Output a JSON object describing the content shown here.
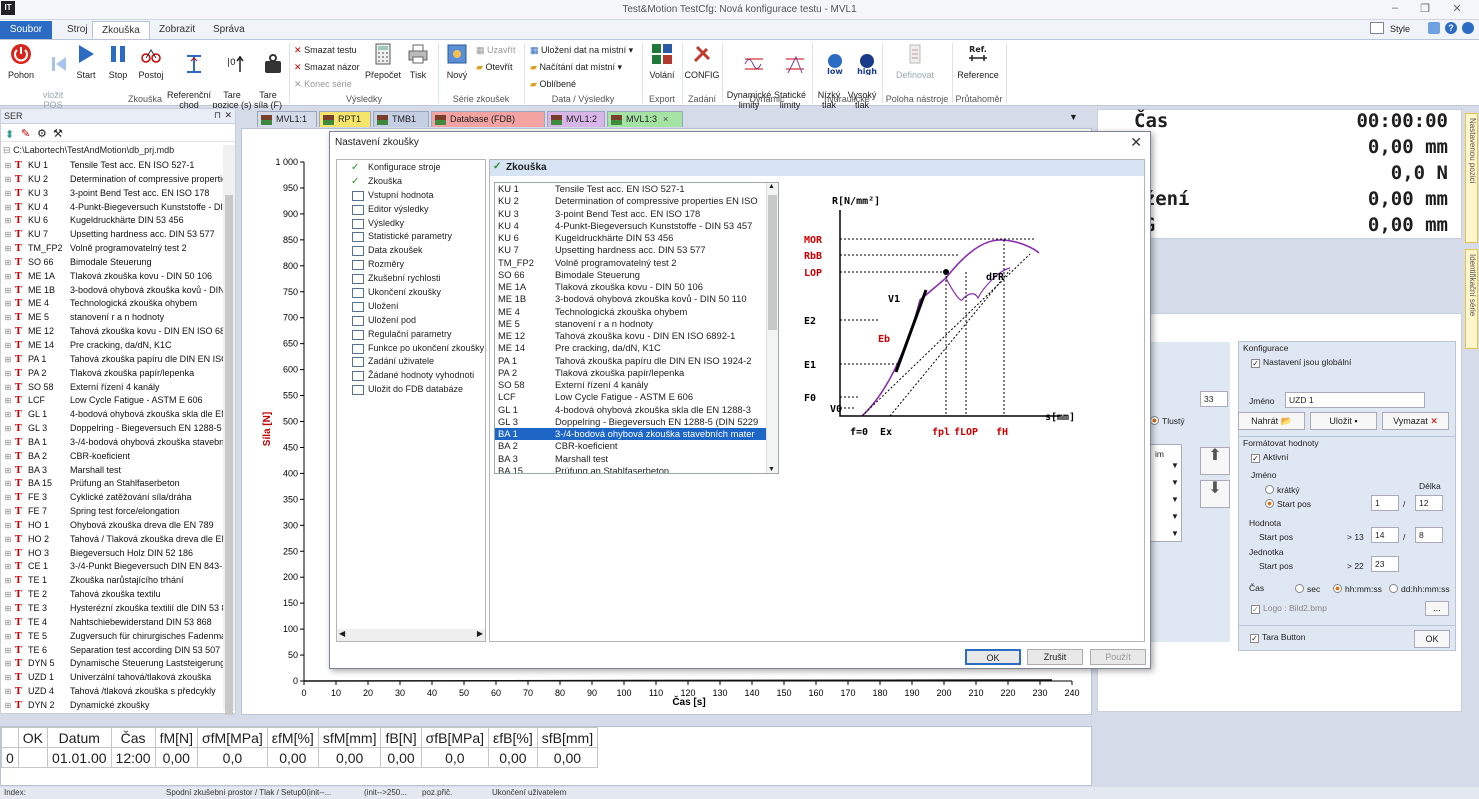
{
  "app": {
    "logo": "IT",
    "title": "Test&Motion  TestCfg: Nová konfigurace testu -  MVL1",
    "style_label": "Style"
  },
  "ribbon_tabs": [
    "Soubor",
    "Stroj",
    "Zkouška",
    "Zobrazit",
    "Správa"
  ],
  "ribbon": {
    "zkouska": {
      "buttons": [
        "Pohon",
        "vložit\nPOS",
        "Start",
        "Stop",
        "Postoj",
        "Referenční\nchod",
        "Tare\npozice (s)",
        "Tare\nsíla (F)"
      ],
      "group": "Zkouška"
    },
    "vysledky": {
      "smazat_testu": "Smazat testu",
      "smazat_nazor": "Smazat názor",
      "konec_serie": "Konec série",
      "prepocet": "Přepočet",
      "tisk": "Tisk",
      "group": "Výsledky"
    },
    "serie": {
      "novy": "Nový",
      "uzavrit": "Uzavřít",
      "otevrit": "Otevřít",
      "group": "Série zkoušek"
    },
    "data": {
      "ulozeni": "Uložení dat na místní",
      "nacitani": "Načítání dat místní",
      "oblibene": "Oblíbené",
      "group": "Data / Výsledky"
    },
    "export": {
      "volani": "Volání",
      "group": "Export"
    },
    "zadani": {
      "config": "CONFIG",
      "group": "Zadání"
    },
    "dynamic": {
      "dyn": "Dynamické\nlimity",
      "stat": "Statické\nlimity",
      "group": "Dynamic"
    },
    "hydraulic": {
      "low": "Nízký\ntlak",
      "high": "Vysoký\ntlak",
      "low_badge": "low",
      "high_badge": "high",
      "group": "hydraulické"
    },
    "poloha": {
      "definovat": "Definovat",
      "group": "Poloha nástroje"
    },
    "prutahomer": {
      "reference": "Reference",
      "ref_badge": "Ref.",
      "group": "Průtahoměr"
    }
  },
  "left_panel": {
    "title": "SER",
    "path": "C:\\Labortech\\TestAndMotion\\db_prj.mdb",
    "items": [
      {
        "code": "KU 1",
        "name": "Tensile Test acc. EN ISO 527-1"
      },
      {
        "code": "KU 2",
        "name": "Determination of compressive properties"
      },
      {
        "code": "KU 3",
        "name": "3-point Bend Test acc. EN ISO 178"
      },
      {
        "code": "KU 4",
        "name": "4-Punkt-Biegeversuch Kunststoffe - DIN"
      },
      {
        "code": "KU 6",
        "name": "Kugeldruckhärte DIN 53 456"
      },
      {
        "code": "KU 7",
        "name": "Upsetting hardness acc. DIN 53 577"
      },
      {
        "code": "TM_FP2",
        "name": "Volně programovatelný test 2"
      },
      {
        "code": "SO 66",
        "name": "Bimodale Steuerung"
      },
      {
        "code": "ME 1A",
        "name": "Tlaková zkouška kovu - DIN 50 106"
      },
      {
        "code": "ME 1B",
        "name": "3-bodová ohybová zkouška kovů - DIN"
      },
      {
        "code": "ME 4",
        "name": "Technologická zkouška ohybem"
      },
      {
        "code": "ME 5",
        "name": "stanovení r a n hodnoty"
      },
      {
        "code": "ME 12",
        "name": "Tahová zkouška kovu - DIN EN ISO 6892"
      },
      {
        "code": "ME 14",
        "name": "Pre cracking, da/dN, K1C"
      },
      {
        "code": "PA 1",
        "name": "Tahová zkouška papíru dle DIN EN ISO 1"
      },
      {
        "code": "PA 2",
        "name": "Tlaková zkouška papír/lepenka"
      },
      {
        "code": "SO 58",
        "name": "Externí řízení 4 kanály"
      },
      {
        "code": "LCF",
        "name": "Low Cycle Fatigue - ASTM E 606"
      },
      {
        "code": "GL 1",
        "name": "4-bodová ohybová zkouška skla dle  EN"
      },
      {
        "code": "GL 3",
        "name": "Doppelring - Biegeversuch EN 1288-5 (D"
      },
      {
        "code": "BA 1",
        "name": "3-/4-bodová ohybová zkouška stavební"
      },
      {
        "code": "BA 2",
        "name": "CBR-koeficient"
      },
      {
        "code": "BA 3",
        "name": "Marshall test"
      },
      {
        "code": "BA 15",
        "name": "Prüfung an Stahlfaserbeton"
      },
      {
        "code": "FE 3",
        "name": "Cyklické zatěžování síla/dráha"
      },
      {
        "code": "FE 7",
        "name": "Spring test force/elongation"
      },
      {
        "code": "HO 1",
        "name": "Ohybová zkouška dreva dle EN 789"
      },
      {
        "code": "HO 2",
        "name": "Tahová / Tlaková zkouška dreva dle EN"
      },
      {
        "code": "HO 3",
        "name": "Biegeversuch Holz  DIN 52 186"
      },
      {
        "code": "CE 1",
        "name": "3-/4-Punkt Biegeversuch DIN EN 843-1,"
      },
      {
        "code": "TE 1",
        "name": "Zkouška narůstajícího trhání"
      },
      {
        "code": "TE 2",
        "name": "Tahová zkouška textilu"
      },
      {
        "code": "TE 3",
        "name": "Hysterézní zkouška textilií dle DIN 53 835"
      },
      {
        "code": "TE 4",
        "name": "Nahtschiebewiderstand DIN 53 868"
      },
      {
        "code": "TE 5",
        "name": "Zugversuch für chirurgisches Fadenmate"
      },
      {
        "code": "TE 6",
        "name": "Separation test according DIN 53 507"
      },
      {
        "code": "DYN 5",
        "name": "Dynamische Steuerung Laststeigerung"
      },
      {
        "code": "UZD 1",
        "name": "Univerzální tahová/tlaková zkouška"
      },
      {
        "code": "UZD 4",
        "name": "Tahová /tlaková zkouška s předcykly"
      },
      {
        "code": "DYN 2",
        "name": "Dynamické zkoušky"
      }
    ]
  },
  "doc_tabs": [
    {
      "label": "MVL1:1",
      "color": "#d6dbe9"
    },
    {
      "label": "RPT1",
      "color": "#f7e46a"
    },
    {
      "label": "TMB1",
      "color": "#c5cfe4"
    },
    {
      "label": "Database (FDB)",
      "color": "#f4a3a3"
    },
    {
      "label": "MVL1:2",
      "color": "#d8b6e8"
    },
    {
      "label": "MVL1:3",
      "color": "#a5e3a5"
    }
  ],
  "chart": {
    "ylabel": "Síla [N]",
    "xlabel": "Čas [s]"
  },
  "chart_data": {
    "type": "line",
    "ylabel": "Síla [N]",
    "xlabel": "Čas [s]",
    "xlim": [
      0,
      240
    ],
    "ylim": [
      0,
      1000
    ],
    "x_ticks": [
      0,
      10,
      20,
      30,
      40,
      50,
      60,
      70,
      80,
      90,
      100,
      110,
      120,
      130,
      140,
      150,
      160,
      170,
      180,
      190,
      200,
      210,
      220,
      230,
      240
    ],
    "y_ticks": [
      0,
      50,
      100,
      150,
      200,
      250,
      300,
      350,
      400,
      450,
      500,
      550,
      600,
      650,
      700,
      750,
      800,
      850,
      900,
      950,
      1000
    ],
    "y_tick_labels": [
      "0",
      "50",
      "100",
      "150",
      "200",
      "250",
      "300",
      "350",
      "400",
      "450",
      "500",
      "550",
      "600",
      "650",
      "700",
      "750",
      "800",
      "850",
      "900",
      "950",
      "1 000"
    ],
    "series": []
  },
  "dialog": {
    "title": "Nastavení zkoušky",
    "close": "✕",
    "header": "Zkouška",
    "nav": [
      {
        "label": "Konfigurace stroje",
        "icon": "check"
      },
      {
        "label": "Zkouška",
        "icon": "check"
      },
      {
        "label": "Vstupní hodnota",
        "icon": "form"
      },
      {
        "label": "Editor výsledky",
        "icon": "form"
      },
      {
        "label": "Výsledky",
        "icon": "form"
      },
      {
        "label": "Statistické parametry",
        "icon": "form"
      },
      {
        "label": "Data zkoušek",
        "icon": "form"
      },
      {
        "label": "Rozměry",
        "icon": "form"
      },
      {
        "label": "Zkušební rychlosti",
        "icon": "form"
      },
      {
        "label": "Ukončení zkoušky",
        "icon": "form"
      },
      {
        "label": "Uložení",
        "icon": "form"
      },
      {
        "label": "Uložení pod",
        "icon": "form"
      },
      {
        "label": "Regulační parametry",
        "icon": "form"
      },
      {
        "label": "Funkce po ukončení zkoušky",
        "icon": "form"
      },
      {
        "label": "Zadání uživatele",
        "icon": "form"
      },
      {
        "label": "Žádané hodnoty vyhodnoti",
        "icon": "form"
      },
      {
        "label": "Uložit do FDB databáze",
        "icon": "form"
      }
    ],
    "tests": [
      {
        "code": "KU 1",
        "name": "Tensile Test acc. EN ISO 527-1"
      },
      {
        "code": "KU 2",
        "name": "Determination of compressive properties EN ISO"
      },
      {
        "code": "KU 3",
        "name": "3-point Bend Test acc. EN ISO 178"
      },
      {
        "code": "KU 4",
        "name": "4-Punkt-Biegeversuch Kunststoffe - DIN 53 457"
      },
      {
        "code": "KU 6",
        "name": "Kugeldruckhärte DIN 53 456"
      },
      {
        "code": "KU 7",
        "name": "Upsetting hardness acc. DIN 53 577"
      },
      {
        "code": "TM_FP2",
        "name": "Volně programovatelný test 2"
      },
      {
        "code": "SO 66",
        "name": "Bimodale Steuerung"
      },
      {
        "code": "ME 1A",
        "name": "Tlaková zkouška kovu - DIN 50 106"
      },
      {
        "code": "ME 1B",
        "name": "3-bodová ohybová zkouška kovů - DIN 50 110"
      },
      {
        "code": "ME 4",
        "name": "Technologická zkouška ohybem"
      },
      {
        "code": "ME 5",
        "name": "stanovení r a n hodnoty"
      },
      {
        "code": "ME 12",
        "name": "Tahová zkouška kovu - DIN EN ISO 6892-1"
      },
      {
        "code": "ME 14",
        "name": "Pre cracking, da/dN, K1C"
      },
      {
        "code": "PA 1",
        "name": "Tahová zkouška papíru dle DIN EN ISO 1924-2"
      },
      {
        "code": "PA 2",
        "name": "Tlaková zkouška papír/lepenka"
      },
      {
        "code": "SO 58",
        "name": "Externí řízení 4 kanály"
      },
      {
        "code": "LCF",
        "name": "Low Cycle Fatigue - ASTM E 606"
      },
      {
        "code": "GL 1",
        "name": "4-bodová ohybová zkouška skla dle  EN 1288-3"
      },
      {
        "code": "GL 3",
        "name": "Doppelring - Biegeversuch EN 1288-5 (DIN 5229"
      },
      {
        "code": "BA 1",
        "name": "3-/4-bodová ohybová zkouška stavebních mater",
        "selected": true
      },
      {
        "code": "BA 2",
        "name": "CBR-koeficient"
      },
      {
        "code": "BA 3",
        "name": "Marshall test"
      },
      {
        "code": "BA 15",
        "name": "Prüfung an Stahlfaserbeton"
      }
    ],
    "diagram": {
      "ylabel": "R[N/mm²]",
      "xlabel": "s[mm]",
      "y_labels": [
        "MOR",
        "RbB",
        "LOP",
        "E2",
        "E1",
        "F0",
        "V0"
      ],
      "x_labels": [
        "f=0",
        "Ex",
        "fpl",
        "fLOP",
        "fH"
      ],
      "curve_labels": [
        "V1",
        "Eb",
        "dFR"
      ]
    },
    "buttons": {
      "ok": "OK",
      "cancel": "Zrušit",
      "apply": "Použít"
    }
  },
  "readout": [
    {
      "label": "Čas",
      "value": "00:00:00"
    },
    {
      "label": "ráha",
      "value": "0,00 mm"
    },
    {
      "label": "íla",
      "value": "0,0 N"
    },
    {
      "label": "rotažení",
      "value": "0,00 mm"
    },
    {
      "label": "L_ORG",
      "value": "0,00 mm"
    }
  ],
  "side_tabs": [
    "Nastavenou pozici",
    "Identifikační série"
  ],
  "config": {
    "konfigurace": "Konfigurace",
    "global": "Nastavení jsou globální",
    "jmeno_label": "Jméno",
    "jmeno": "UZD 1",
    "nahrat": "Nahrát",
    "ulozit": "Uložit",
    "vymazat": "Vymazat",
    "tlusty": "Tlustý",
    "size": "33",
    "formatovat": "Formátovat hodnoty",
    "aktivni": "Aktivní",
    "jmeno2": "Jméno",
    "delka": "Délka",
    "kratky": "krátký",
    "start_pos": "Start pos",
    "jm_start": "1",
    "jm_len": "12",
    "hodnota": "Hodnota",
    "hod_gt": "> 13",
    "hod_start": "14",
    "hod_len": "8",
    "jednotka": "Jednotka",
    "jed_gt": "> 22",
    "jed_start": "23",
    "cas": "Čas",
    "sec": "sec",
    "hhmmss": "hh:mm:ss",
    "ddhhmmss": "dd:hh:mm:ss",
    "logo": "Logo : Bild2.bmp",
    "dots": "...",
    "tara": "Tara Button",
    "ok": "OK",
    "im": "im"
  },
  "results": {
    "headers": [
      "",
      "OK",
      "Datum",
      "Čas",
      "fM[N]",
      "σfM[MPa]",
      "εfM[%]",
      "sfM[mm]",
      "fB[N]",
      "σfB[MPa]",
      "εfB[%]",
      "sfB[mm]"
    ],
    "row": [
      "0",
      "",
      "01.01.00",
      "12:00",
      "0,00",
      "0,0",
      "0,00",
      "0,00",
      "0,00",
      "0,0",
      "0,00",
      "0,00"
    ]
  },
  "status": {
    "index": "Index:",
    "s1": "Spodní zkušební prostor / Tlak / Setup0(init--...",
    "s2": "(init-->250...",
    "s3": "poz.přič.",
    "s4": "Ukončení uživatelem"
  },
  "colors": {
    "accent": "#2b6bc3",
    "selection": "#1d66c5",
    "axis_label": "#c00000"
  }
}
